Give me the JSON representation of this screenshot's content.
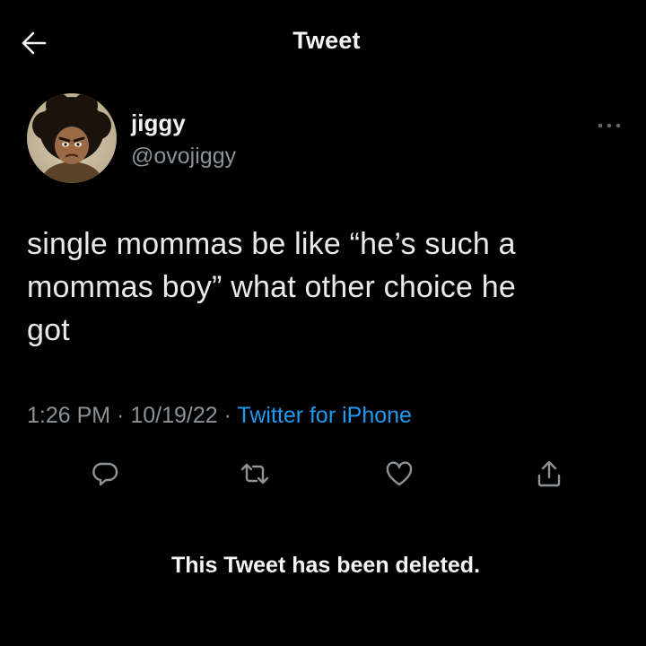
{
  "header": {
    "title": "Tweet",
    "back_icon": "arrow-left-icon"
  },
  "author": {
    "display_name": "jiggy",
    "handle": "@ovojiggy",
    "avatar": "avatar-cartoon-afro"
  },
  "tweet": {
    "lines": [
      "single mommas be like “he’s such a",
      "mommas boy” what other choice he",
      "got"
    ],
    "time": "1:26 PM",
    "date": "10/19/22",
    "separator": " · ",
    "source": "Twitter for iPhone"
  },
  "actions": [
    {
      "name": "reply",
      "icon": "reply-icon"
    },
    {
      "name": "retweet",
      "icon": "retweet-icon"
    },
    {
      "name": "like",
      "icon": "heart-icon"
    },
    {
      "name": "share",
      "icon": "share-icon"
    }
  ],
  "notice": {
    "deleted_text": "This Tweet has been deleted."
  },
  "colors": {
    "background": "#000000",
    "text_primary": "#e7e9ea",
    "text_secondary": "#8b9298",
    "accent": "#1d9bf0"
  }
}
